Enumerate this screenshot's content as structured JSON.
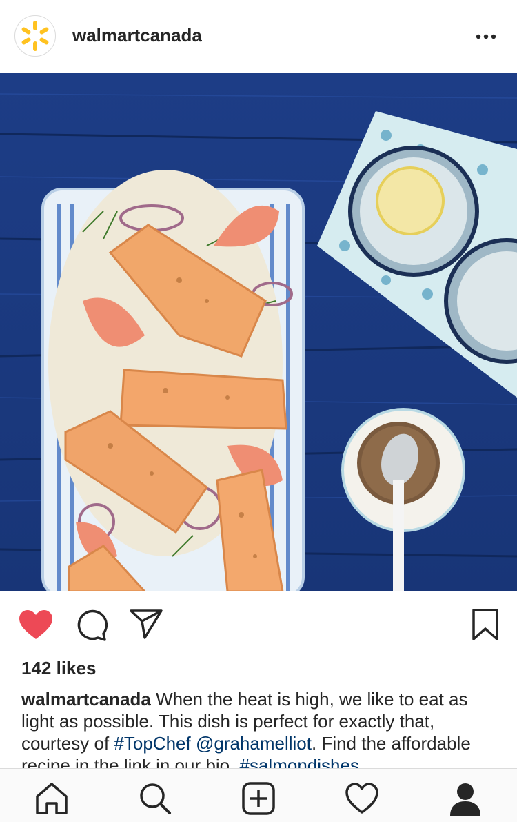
{
  "header": {
    "username": "walmartcanada",
    "more_icon": "more-horizontal-icon"
  },
  "post": {
    "image_alt": "Roasted salmon fillets on a striped platter with grapefruit, fennel and onion, glasses of lemon water, and a bowl of dressing on a blue wooden table"
  },
  "actions": {
    "like_icon": "heart-filled-icon",
    "comment_icon": "comment-icon",
    "share_icon": "paper-plane-icon",
    "save_icon": "bookmark-icon",
    "like_color": "#ed4956"
  },
  "likes": "142 likes",
  "caption": {
    "username": "walmartcanada",
    "text_1": " When the heat is high, we like to eat as light as possible. This dish is perfect for exactly that, courtesy of ",
    "hashtag_1": "#TopChef",
    "space": " ",
    "mention": "@grahamelliot",
    "text_2": ". Find the affordable recipe in the link in our bio. ",
    "hashtag_2": "#salmondishes"
  },
  "tabbar": {
    "home": "home-icon",
    "search": "search-icon",
    "new_post": "add-post-icon",
    "activity": "heart-outline-icon",
    "profile": "profile-icon"
  },
  "colors": {
    "link": "#003569",
    "text": "#262626",
    "wood": "#1b3f8f"
  }
}
